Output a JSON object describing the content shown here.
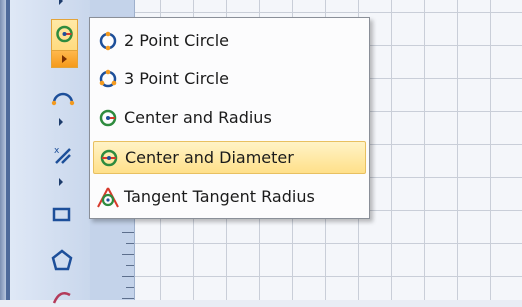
{
  "circle_menu": {
    "items": [
      {
        "label": "2 Point Circle",
        "icon": "two-point-circle-icon",
        "highlighted": false
      },
      {
        "label": "3 Point Circle",
        "icon": "three-point-circle-icon",
        "highlighted": false
      },
      {
        "label": "Center and Radius",
        "icon": "center-radius-icon",
        "highlighted": false
      },
      {
        "label": "Center and Diameter",
        "icon": "center-diameter-icon",
        "highlighted": true
      },
      {
        "label": "Tangent Tangent Radius",
        "icon": "tangent-tangent-radius-icon",
        "highlighted": false
      }
    ]
  },
  "colors": {
    "highlight_fill": "#ffe08a",
    "highlight_border": "#e8c061",
    "icon_green": "#2e8b3e",
    "icon_orange": "#f39a1f",
    "icon_blue": "#1d4f9a",
    "icon_red": "#d63a2c"
  }
}
